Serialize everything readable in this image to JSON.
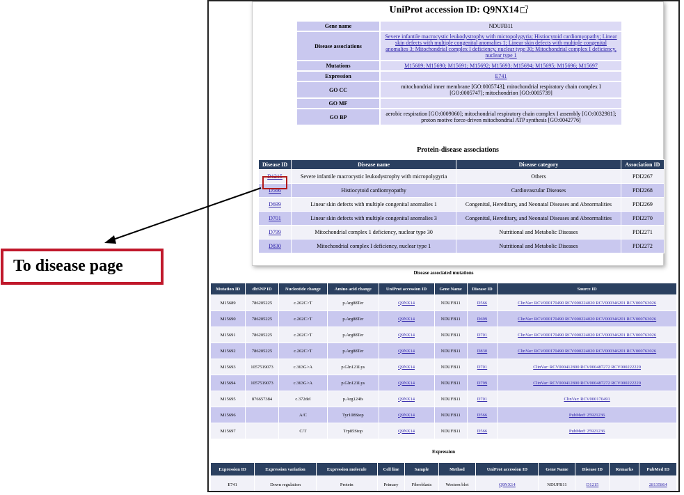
{
  "uniprot": {
    "title": "UniProt accession ID: Q9NX14",
    "gene_rows": [
      {
        "key": "Gene name",
        "value": "NDUFB11",
        "link": false
      },
      {
        "key": "Disease associations",
        "value": "Severe infantile macrocystic leukodystrophy with micropolygyria; Histiocytoid cardiomyopathy; Linear skin defects with multiple congenital anomalies 1; Linear skin defects with multiple congenital anomalies 3; Mitochondrial complex I deficiency, nuclear type 30; Mitochondrial complex I deficiency, nuclear type 1",
        "link": true
      },
      {
        "key": "Mutations",
        "value": "M15689; M15690; M15691; M15692; M15693; M15694; M15695; M15696; M15697",
        "link": true
      },
      {
        "key": "Expression",
        "value": "E741",
        "link": true
      },
      {
        "key": "GO CC",
        "value": "mitochondrial inner membrane [GO:0005743]; mitochondrial respiratory chain complex I [GO:0005747]; mitochondrion [GO:0005739]",
        "link": false
      },
      {
        "key": "GO MF",
        "value": "",
        "link": false
      },
      {
        "key": "GO BP",
        "value": "aerobic respiration [GO:0009060]; mitochondrial respiratory chain complex I assembly [GO:0032981]; proton motive force-driven mitochondrial ATP synthesis [GO:0042776]",
        "link": false
      }
    ]
  },
  "protein_disease": {
    "title": "Protein-disease associations",
    "headers": [
      "Disease ID",
      "Disease name",
      "Disease category",
      "Association ID"
    ],
    "rows": [
      [
        "D1215",
        "Severe infantile macrocystic leukodystrophy with micropolygyria",
        "Others",
        "PDI2267"
      ],
      [
        "D566",
        "Histiocytoid cardiomyopathy",
        "Cardiovascular Diseases",
        "PDI2268"
      ],
      [
        "D699",
        "Linear skin defects with multiple congenital anomalies 1",
        "Congenital, Hereditary, and Neonatal Diseases and Abnormalities",
        "PDI2269"
      ],
      [
        "D701",
        "Linear skin defects with multiple congenital anomalies 3",
        "Congenital, Hereditary, and Neonatal Diseases and Abnormalities",
        "PDI2270"
      ],
      [
        "D799",
        "Mitochondrial complex 1 deficiency, nuclear type 30",
        "Nutritional and Metabolic Diseases",
        "PDI2271"
      ],
      [
        "D830",
        "Mitochondrial complex I deficiency, nuclear type 1",
        "Nutritional and Metabolic Diseases",
        "PDI2272"
      ]
    ]
  },
  "mutations": {
    "title": "Disease associated mutations",
    "headers": [
      "Mutation ID",
      "dbSNP ID",
      "Nucleotide change",
      "Amino acid change",
      "UniProt accession ID",
      "Gene Name",
      "Disease ID",
      "Source ID"
    ],
    "rows": [
      [
        "M15689",
        "786205225",
        "c.262C>T",
        "p.Arg88Ter",
        "Q9NX14",
        "NDUFB11",
        "D566",
        "ClinVar: RCV000170490 RCV000224020 RCV000346201 RCV000763026"
      ],
      [
        "M15690",
        "786205225",
        "c.262C>T",
        "p.Arg88Ter",
        "Q9NX14",
        "NDUFB11",
        "D699",
        "ClinVar: RCV000170490 RCV000224020 RCV000346201 RCV000763026"
      ],
      [
        "M15691",
        "786205225",
        "c.262C>T",
        "p.Arg88Ter",
        "Q9NX14",
        "NDUFB11",
        "D701",
        "ClinVar: RCV000170490 RCV000224020 RCV000346201 RCV000763026"
      ],
      [
        "M15692",
        "786205225",
        "c.262C>T",
        "p.Arg88Ter",
        "Q9NX14",
        "NDUFB11",
        "D830",
        "ClinVar: RCV000170490 RCV000224020 RCV000346201 RCV000763026"
      ],
      [
        "M15693",
        "1057519073",
        "c.363G>A",
        "p.Gln121Lys",
        "Q9NX14",
        "NDUFB11",
        "D701",
        "ClinVar: RCV000412800 RCV000487272 RCV000222220"
      ],
      [
        "M15694",
        "1057519073",
        "c.363G>A",
        "p.Gln121Lys",
        "Q9NX14",
        "NDUFB11",
        "D799",
        "ClinVar: RCV000412800 RCV000487272 RCV000222220"
      ],
      [
        "M15695",
        "876657384",
        "c.372del",
        "p.Arg124fs",
        "Q9NX14",
        "NDUFB11",
        "D701",
        "ClinVar: RCV000170491"
      ],
      [
        "M15696",
        "",
        "A/C",
        "Tyr108Stop",
        "Q9NX14",
        "NDUFB11",
        "D566",
        "PubMed: 25921236"
      ],
      [
        "M15697",
        "",
        "C/T",
        "Trp85Stop",
        "Q9NX14",
        "NDUFB11",
        "D566",
        "PubMed: 25921236"
      ]
    ]
  },
  "expression": {
    "title": "Expression",
    "headers": [
      "Expression ID",
      "Expression variation",
      "Expression molecule",
      "Cell line",
      "Sample",
      "Method",
      "UniProt accession ID",
      "Gene Name",
      "Disease ID",
      "Remarks",
      "PubMed ID"
    ],
    "rows": [
      [
        "E741",
        "Down regulation",
        "Protein",
        "Primary",
        "Fibroblasts",
        "Western blot",
        "Q9NX14",
        "NDUFB11",
        "D1215",
        "",
        "28135864"
      ]
    ]
  },
  "callout": {
    "label": "To disease page"
  },
  "colors": {
    "header": "#2b4060",
    "row_alt": "#c9c8ef",
    "callout_border": "#c0182b",
    "link": "#2a1fa8"
  }
}
